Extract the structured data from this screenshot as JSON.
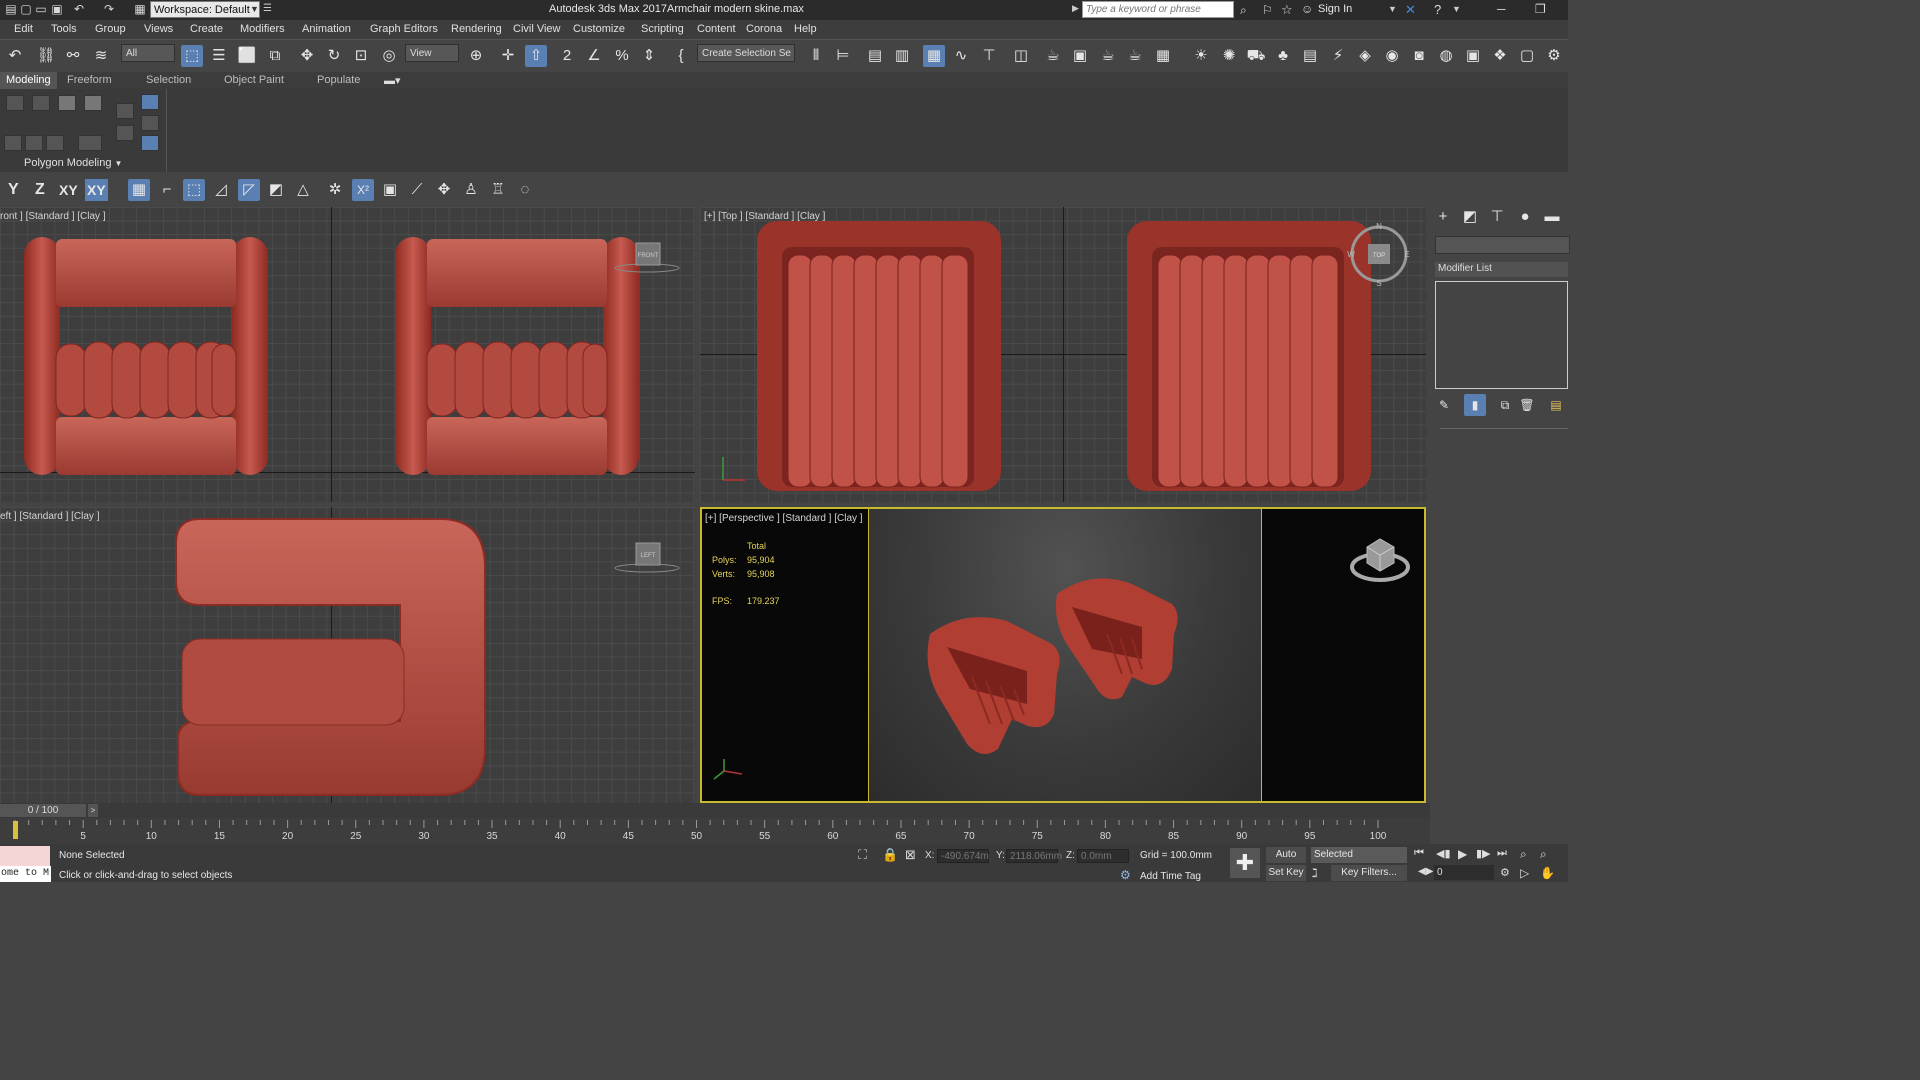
{
  "titlebar": {
    "workspace": "Workspace: Default",
    "app_title": "Autodesk 3ds Max 2017",
    "file_title": "Armchair modern skine.max",
    "search_placeholder": "Type a keyword or phrase",
    "signin": "Sign In"
  },
  "menu": [
    "Edit",
    "Tools",
    "Group",
    "Views",
    "Create",
    "Modifiers",
    "Animation",
    "Graph Editors",
    "Rendering",
    "Civil View",
    "Customize",
    "Scripting",
    "Content",
    "Corona",
    "Help"
  ],
  "toolbar": {
    "filter": "All",
    "ref_coord": "View",
    "selection_set": "Create Selection Se"
  },
  "ribbon": {
    "tabs": [
      "Modeling",
      "Freeform",
      "Selection",
      "Object Paint",
      "Populate"
    ],
    "panel_label": "Polygon Modeling"
  },
  "constraints": {
    "y": "Y",
    "z": "Z",
    "xy": "XY",
    "xy2": "XY"
  },
  "viewports": {
    "front_label": "ront ] [Standard ] [Clay ]",
    "top_label": "[+] [Top ] [Standard ] [Clay ]",
    "left_label": "eft ] [Standard ] [Clay ]",
    "persp_label": "[+] [Perspective ] [Standard ] [Clay ]",
    "viewcube_front": "FRONT",
    "viewcube_top": "TOP",
    "viewcube_left": "LEFT",
    "compass": {
      "n": "N",
      "s": "S",
      "e": "E",
      "w": "W"
    },
    "stats": {
      "total_label": "Total",
      "polys_label": "Polys:",
      "polys": "95,904",
      "verts_label": "Verts:",
      "verts": "95,908",
      "fps_label": "FPS:",
      "fps": "179.237"
    }
  },
  "command_panel": {
    "modifier_list": "Modifier List"
  },
  "timeline": {
    "frame": "0 / 100",
    "ticks": [
      "5",
      "10",
      "15",
      "20",
      "25",
      "30",
      "35",
      "40",
      "45",
      "50",
      "55",
      "60",
      "65",
      "70",
      "75",
      "80",
      "85",
      "90",
      "95",
      "100"
    ]
  },
  "status": {
    "maxscript": "ome to M",
    "selected": "None Selected",
    "prompt": "Click or click-and-drag to select objects",
    "x_label": "X:",
    "x": "-490.674m",
    "y_label": "Y:",
    "y": "2118.06mm",
    "z_label": "Z:",
    "z": "0.0mm",
    "grid": "Grid = 100.0mm",
    "add_time_tag": "Add Time Tag",
    "auto_key": "Auto Key",
    "set_key": "Set Key",
    "key_mode": "Selected",
    "key_filters": "Key Filters...",
    "current_frame": "0"
  },
  "colors": {
    "accent": "#5a7fb2",
    "chair": "#b5423a",
    "viewport_active": "#c9b92f"
  }
}
